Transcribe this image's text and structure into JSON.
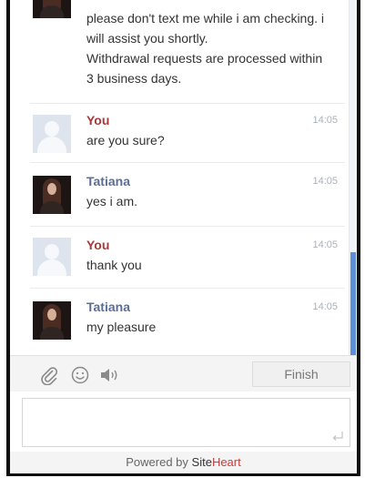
{
  "messages": [
    {
      "role": "agent",
      "sender": "",
      "time": "",
      "lines": [
        "please don't text me while i am checking. i",
        "will assist you shortly.",
        "Withdrawal requests are processed within",
        "3 business days."
      ]
    },
    {
      "role": "user",
      "sender": "You",
      "time": "14:05",
      "lines": [
        "are you sure?"
      ]
    },
    {
      "role": "agent",
      "sender": "Tatiana",
      "time": "14:05",
      "lines": [
        "yes i am."
      ]
    },
    {
      "role": "user",
      "sender": "You",
      "time": "14:05",
      "lines": [
        "thank you"
      ]
    },
    {
      "role": "agent",
      "sender": "Tatiana",
      "time": "14:05",
      "lines": [
        "my pleasure"
      ]
    }
  ],
  "toolbar": {
    "icons": [
      "paperclip-icon",
      "smiley-icon",
      "speaker-icon"
    ],
    "finish_label": "Finish"
  },
  "input": {
    "value": "",
    "placeholder": ""
  },
  "footer": {
    "powered_by": "Powered by ",
    "brand_site": "Site",
    "brand_heart": "Heart"
  },
  "colors": {
    "you_name": "#a63a3a",
    "agent_name": "#5a6f93",
    "scroll_thumb": "#5b8fd6",
    "brand_heart": "#c73a3a"
  }
}
